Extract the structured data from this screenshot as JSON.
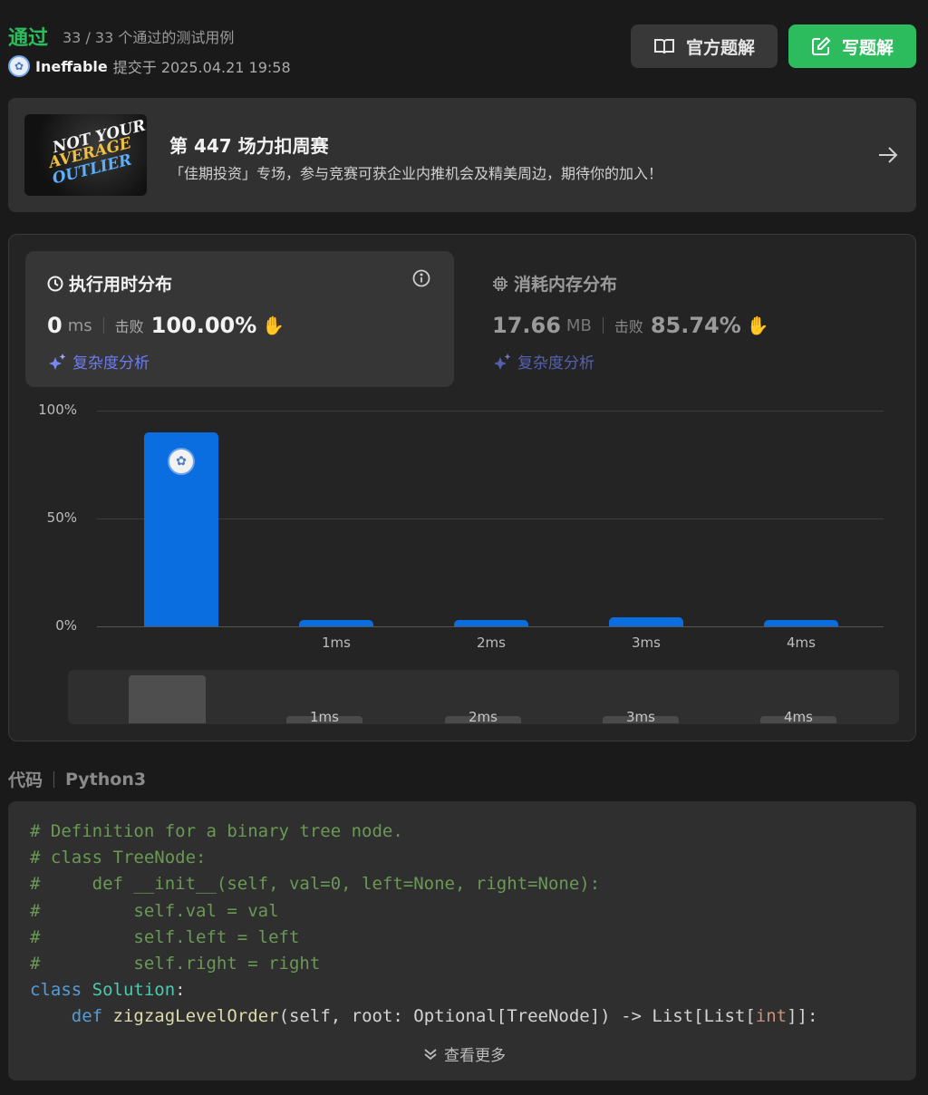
{
  "header": {
    "status": "通过",
    "test_count": "33 / 33 个通过的测试用例",
    "username": "Ineffable",
    "submitted": "提交于 2025.04.21 19:58",
    "official_solution_label": "官方题解",
    "write_solution_label": "写题解"
  },
  "banner": {
    "title": "第 447 场力扣周赛",
    "description": "「佳期投资」专场，参与竞赛可获企业内推机会及精美周边，期待你的加入！",
    "image_text": [
      "NOT YOUR",
      "AVERAGE",
      "OUTLIER"
    ]
  },
  "stats": {
    "runtime": {
      "title": "执行用时分布",
      "value": "0",
      "unit": "ms",
      "beats_label": "击败",
      "beats": "100.00%",
      "complexity_label": "复杂度分析"
    },
    "memory": {
      "title": "消耗内存分布",
      "value": "17.66",
      "unit": "MB",
      "beats_label": "击败",
      "beats": "85.74%",
      "complexity_label": "复杂度分析"
    }
  },
  "chart_data": {
    "type": "bar",
    "categories": [
      "0ms",
      "1ms",
      "2ms",
      "3ms",
      "4ms"
    ],
    "tick_labels": [
      "",
      "1ms",
      "2ms",
      "3ms",
      "4ms"
    ],
    "values": [
      90,
      3,
      3,
      4,
      3
    ],
    "y_ticks": [
      "100%",
      "50%",
      "0%"
    ],
    "ylim": [
      0,
      100
    ],
    "highlighted_category": "0ms",
    "minimap_labels": [
      "1ms",
      "2ms",
      "3ms",
      "4ms"
    ]
  },
  "code": {
    "label": "代码",
    "language": "Python3",
    "show_more": "查看更多"
  },
  "colors": {
    "accepted": "#2cbb5d",
    "bar": "#0a6ee0",
    "complexity": "#6d7cf0"
  }
}
